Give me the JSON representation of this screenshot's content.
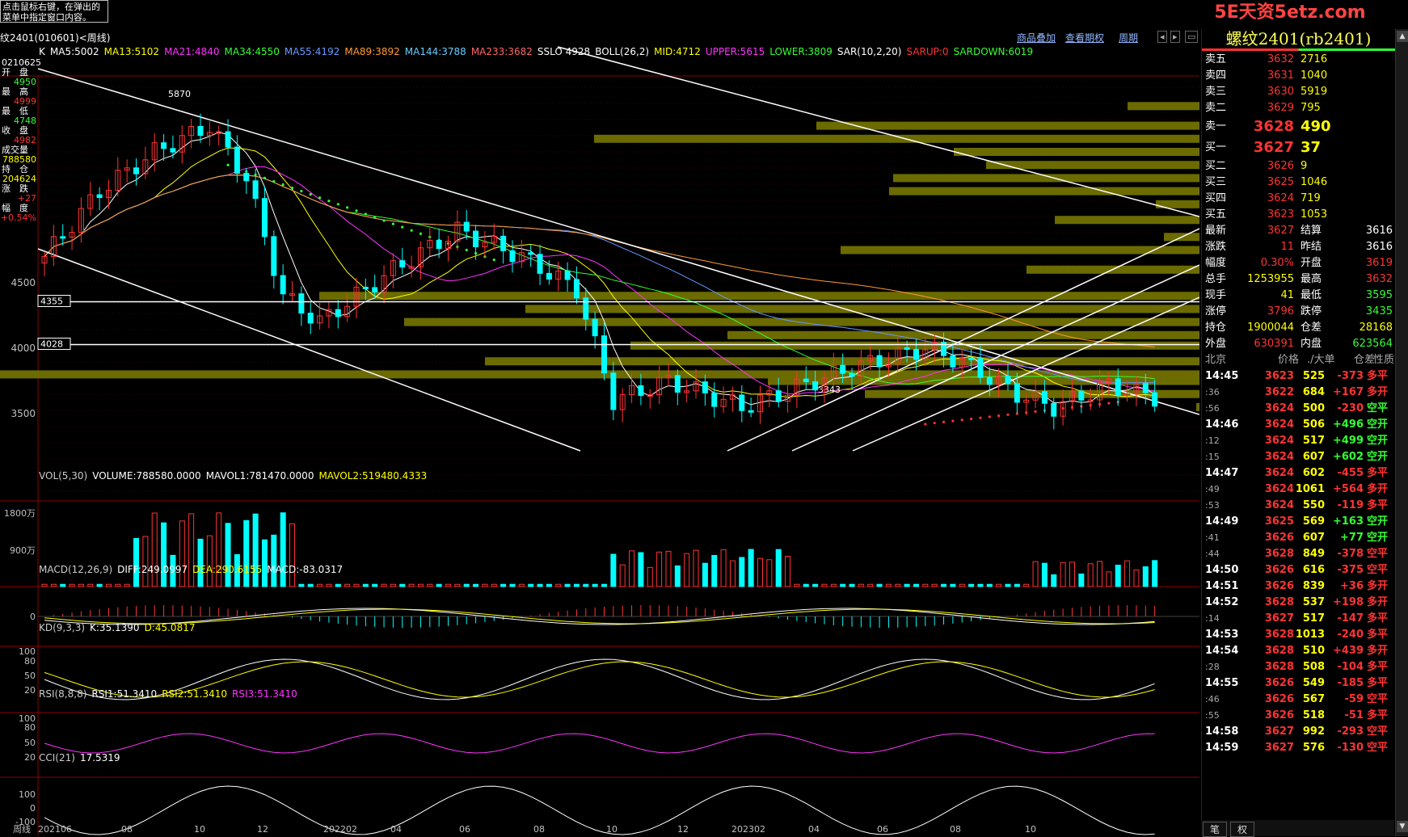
{
  "tooltip": {
    "lines": [
      "点击鼠标右键，在弹出的",
      "菜单中指定窗口内容。"
    ]
  },
  "brand": "5E天资5etz.com",
  "topbar": {
    "instrument": "纹2401(010601)<周线)",
    "links": [
      "商品叠加",
      "查看期权",
      "周期"
    ]
  },
  "legend_main": [
    {
      "text": "K",
      "color": "#ffffff"
    },
    {
      "text": "MA5:5002",
      "color": "#ffffff"
    },
    {
      "text": "MA13:5102",
      "color": "#ffff00"
    },
    {
      "text": "MA21:4840",
      "color": "#ff33ff"
    },
    {
      "text": "MA34:4550",
      "color": "#33ff33"
    },
    {
      "text": "MA55:4192",
      "color": "#6699ff"
    },
    {
      "text": "MA89:3892",
      "color": "#ff9933"
    },
    {
      "text": "MA144:3788",
      "color": "#66ccff"
    },
    {
      "text": "MA233:3682",
      "color": "#ff6666"
    },
    {
      "text": "SSLO 4928",
      "color": "#ffffff"
    },
    {
      "text": "BOLL(26,2)",
      "color": "#ffffff"
    },
    {
      "text": "MID:4712",
      "color": "#ffff00"
    },
    {
      "text": "UPPER:5615",
      "color": "#ff33ff"
    },
    {
      "text": "LOWER:3809",
      "color": "#33ff33"
    },
    {
      "text": "SAR(10,2,20)",
      "color": "#ffffff"
    },
    {
      "text": "SARUP:0",
      "color": "#ff3333"
    },
    {
      "text": "SARDOWN:6019",
      "color": "#33ff33"
    }
  ],
  "left_info": [
    {
      "label": "0210625",
      "value": ""
    },
    {
      "label": "开　盘",
      "value": "4950",
      "color": "#33ff33"
    },
    {
      "label": "最　高",
      "value": "4999",
      "color": "#ff3333"
    },
    {
      "label": "最　低",
      "value": "4748",
      "color": "#33ff33"
    },
    {
      "label": "收　盘",
      "value": "4982",
      "color": "#ff3333"
    },
    {
      "label": "成交量",
      "value": "788580",
      "color": "#ffff00"
    },
    {
      "label": "持　仓",
      "value": "204624",
      "color": "#ffff00"
    },
    {
      "label": "涨　跌",
      "value": "+27",
      "color": "#ff3333"
    },
    {
      "label": "幅　度",
      "value": "+0.54%",
      "color": "#ff3333"
    }
  ],
  "price_axis": {
    "labels": [
      "4500",
      "4000",
      "3500"
    ],
    "values": [
      4500,
      4000,
      3500
    ],
    "marks": [
      "4355",
      "4028"
    ]
  },
  "annotations": {
    "high": "5870",
    "low": "3343"
  },
  "vol": {
    "legend": [
      {
        "text": "VOL(5,30)",
        "color": "#cccccc"
      },
      {
        "text": "VOLUME:788580.0000",
        "color": "#ffffff"
      },
      {
        "text": "MAVOL1:781470.0000",
        "color": "#ffffff"
      },
      {
        "text": "MAVOL2:519480.4333",
        "color": "#ffff00"
      }
    ],
    "axis": [
      "1800万",
      "900万"
    ]
  },
  "macd": {
    "legend": [
      {
        "text": "MACD(12,26,9)",
        "color": "#cccccc"
      },
      {
        "text": "DIFF:249.0997",
        "color": "#ffffff"
      },
      {
        "text": "DEA:290.6155",
        "color": "#ffff00"
      },
      {
        "text": "MACD:-83.0317",
        "color": "#ffffff"
      }
    ],
    "axis": [
      "0"
    ]
  },
  "kd": {
    "legend": [
      {
        "text": "KD(9,3,3)",
        "color": "#cccccc"
      },
      {
        "text": "K:35.1390",
        "color": "#ffffff"
      },
      {
        "text": "D:45.0817",
        "color": "#ffff00"
      }
    ],
    "axis": [
      "100",
      "80",
      "50",
      "20"
    ]
  },
  "rsi": {
    "legend": [
      {
        "text": "RSI(8,8,8)",
        "color": "#cccccc"
      },
      {
        "text": "RSI1:51.3410",
        "color": "#ffffff"
      },
      {
        "text": "RSI2:51.3410",
        "color": "#ffff00"
      },
      {
        "text": "RSI3:51.3410",
        "color": "#ff33ff"
      }
    ],
    "axis": [
      "100",
      "80",
      "50",
      "20"
    ]
  },
  "cci": {
    "legend": [
      {
        "text": "CCI(21)",
        "color": "#cccccc"
      },
      {
        "text": "17.5319",
        "color": "#ffffff"
      }
    ],
    "axis": [
      "100",
      "0",
      "-100"
    ]
  },
  "time_axis": {
    "period_label": "周线",
    "labels": [
      "202106",
      "08",
      "10",
      "12",
      "202202",
      "04",
      "06",
      "08",
      "10",
      "12",
      "202302",
      "04",
      "06",
      "08",
      "10"
    ]
  },
  "quote": {
    "title": "螺纹2401(rb2401)",
    "asks": [
      {
        "label": "卖五",
        "price": "3632",
        "vol": "2716"
      },
      {
        "label": "卖四",
        "price": "3631",
        "vol": "1040"
      },
      {
        "label": "卖三",
        "price": "3630",
        "vol": "5919"
      },
      {
        "label": "卖二",
        "price": "3629",
        "vol": "795"
      },
      {
        "label": "卖一",
        "price": "3628",
        "vol": "490"
      }
    ],
    "bids": [
      {
        "label": "买一",
        "price": "3627",
        "vol": "37"
      },
      {
        "label": "买二",
        "price": "3626",
        "vol": "9"
      },
      {
        "label": "买三",
        "price": "3625",
        "vol": "1046"
      },
      {
        "label": "买四",
        "price": "3624",
        "vol": "719"
      },
      {
        "label": "买五",
        "price": "3623",
        "vol": "1053"
      }
    ],
    "stats": [
      {
        "l1": "最新",
        "v1": "3627",
        "c1": "#ff3333",
        "l2": "结算",
        "v2": "3616",
        "c2": "#ffffff"
      },
      {
        "l1": "涨跌",
        "v1": "11",
        "c1": "#ff3333",
        "l2": "昨结",
        "v2": "3616",
        "c2": "#ffffff"
      },
      {
        "l1": "幅度",
        "v1": "0.30%",
        "c1": "#ff3333",
        "l2": "开盘",
        "v2": "3619",
        "c2": "#ff3333"
      },
      {
        "l1": "总手",
        "v1": "1253955",
        "c1": "#ffff00",
        "l2": "最高",
        "v2": "3632",
        "c2": "#ff3333"
      },
      {
        "l1": "现手",
        "v1": "41",
        "c1": "#ffff00",
        "l2": "最低",
        "v2": "3595",
        "c2": "#33ff33"
      },
      {
        "l1": "涨停",
        "v1": "3796",
        "c1": "#ff3333",
        "l2": "跌停",
        "v2": "3435",
        "c2": "#33ff33"
      },
      {
        "l1": "持仓",
        "v1": "1900044",
        "c1": "#ffff00",
        "l2": "仓差",
        "v2": "28168",
        "c2": "#ffff00"
      },
      {
        "l1": "外盘",
        "v1": "630391",
        "c1": "#ff3333",
        "l2": "内盘",
        "v2": "623564",
        "c2": "#33ff33"
      }
    ],
    "ticks_header": [
      "北京",
      "价格",
      "./大单",
      "仓差",
      "性质"
    ],
    "ticks": [
      {
        "time": "14:45",
        "price": "3623",
        "pc": "#ff3333",
        "vol": "525",
        "diff": "-373",
        "dc": "#ff3333",
        "nature": "多平",
        "nc": "#ff3333",
        "major": true
      },
      {
        "time": ":36",
        "price": "3622",
        "pc": "#ff3333",
        "vol": "684",
        "diff": "+167",
        "dc": "#ff3333",
        "nature": "多开",
        "nc": "#ff3333",
        "major": false
      },
      {
        "time": ":56",
        "price": "3624",
        "pc": "#ff3333",
        "vol": "500",
        "diff": "-230",
        "dc": "#ff3333",
        "nature": "空平",
        "nc": "#33ff33",
        "major": false
      },
      {
        "time": "14:46",
        "price": "3624",
        "pc": "#ff3333",
        "vol": "506",
        "diff": "+496",
        "dc": "#33ff33",
        "nature": "空开",
        "nc": "#33ff33",
        "major": true
      },
      {
        "time": ":12",
        "price": "3624",
        "pc": "#ff3333",
        "vol": "517",
        "diff": "+499",
        "dc": "#33ff33",
        "nature": "空开",
        "nc": "#33ff33",
        "major": false
      },
      {
        "time": ":15",
        "price": "3624",
        "pc": "#ff3333",
        "vol": "607",
        "diff": "+602",
        "dc": "#33ff33",
        "nature": "空开",
        "nc": "#33ff33",
        "major": false
      },
      {
        "time": "14:47",
        "price": "3624",
        "pc": "#ff3333",
        "vol": "602",
        "diff": "-455",
        "dc": "#ff3333",
        "nature": "多平",
        "nc": "#ff3333",
        "major": true
      },
      {
        "time": ":49",
        "price": "3624",
        "pc": "#ff3333",
        "vol": "1061",
        "diff": "+564",
        "dc": "#ff3333",
        "nature": "多开",
        "nc": "#ff3333",
        "major": false
      },
      {
        "time": ":53",
        "price": "3624",
        "pc": "#ff3333",
        "vol": "550",
        "diff": "-119",
        "dc": "#ff3333",
        "nature": "多平",
        "nc": "#ff3333",
        "major": false
      },
      {
        "time": "14:49",
        "price": "3625",
        "pc": "#ff3333",
        "vol": "569",
        "diff": "+163",
        "dc": "#33ff33",
        "nature": "空开",
        "nc": "#33ff33",
        "major": true
      },
      {
        "time": ":41",
        "price": "3626",
        "pc": "#ff3333",
        "vol": "607",
        "diff": "+77",
        "dc": "#33ff33",
        "nature": "空开",
        "nc": "#33ff33",
        "major": false
      },
      {
        "time": ":44",
        "price": "3628",
        "pc": "#ff3333",
        "vol": "849",
        "diff": "-378",
        "dc": "#ff3333",
        "nature": "空平",
        "nc": "#ff3333",
        "major": false
      },
      {
        "time": "14:50",
        "price": "3626",
        "pc": "#ff3333",
        "vol": "616",
        "diff": "-375",
        "dc": "#ff3333",
        "nature": "空平",
        "nc": "#ff3333",
        "major": true
      },
      {
        "time": "14:51",
        "price": "3626",
        "pc": "#ff3333",
        "vol": "839",
        "diff": "+36",
        "dc": "#ff3333",
        "nature": "多开",
        "nc": "#ff3333",
        "major": true
      },
      {
        "time": "14:52",
        "price": "3628",
        "pc": "#ff3333",
        "vol": "537",
        "diff": "+198",
        "dc": "#ff3333",
        "nature": "多开",
        "nc": "#ff3333",
        "major": true
      },
      {
        "time": ":14",
        "price": "3627",
        "pc": "#ff3333",
        "vol": "517",
        "diff": "-147",
        "dc": "#ff3333",
        "nature": "多平",
        "nc": "#ff3333",
        "major": false
      },
      {
        "time": "14:53",
        "price": "3628",
        "pc": "#ff3333",
        "vol": "1013",
        "diff": "-240",
        "dc": "#ff3333",
        "nature": "多平",
        "nc": "#ff3333",
        "major": true
      },
      {
        "time": "14:54",
        "price": "3628",
        "pc": "#ff3333",
        "vol": "510",
        "diff": "+439",
        "dc": "#ff3333",
        "nature": "多开",
        "nc": "#ff3333",
        "major": true
      },
      {
        "time": ":28",
        "price": "3628",
        "pc": "#ff3333",
        "vol": "508",
        "diff": "-104",
        "dc": "#ff3333",
        "nature": "多平",
        "nc": "#ff3333",
        "major": false
      },
      {
        "time": "14:55",
        "price": "3626",
        "pc": "#ff3333",
        "vol": "549",
        "diff": "-185",
        "dc": "#ff3333",
        "nature": "多平",
        "nc": "#ff3333",
        "major": true
      },
      {
        "time": ":46",
        "price": "3626",
        "pc": "#ff3333",
        "vol": "567",
        "diff": "-59",
        "dc": "#ff3333",
        "nature": "空平",
        "nc": "#ff3333",
        "major": false
      },
      {
        "time": ":55",
        "price": "3626",
        "pc": "#ff3333",
        "vol": "518",
        "diff": "-51",
        "dc": "#ff3333",
        "nature": "多平",
        "nc": "#ff3333",
        "major": false
      },
      {
        "time": "14:58",
        "price": "3627",
        "pc": "#ff3333",
        "vol": "992",
        "diff": "-293",
        "dc": "#ff3333",
        "nature": "空平",
        "nc": "#ff3333",
        "major": true
      },
      {
        "time": "14:59",
        "price": "3627",
        "pc": "#ff3333",
        "vol": "576",
        "diff": "-130",
        "dc": "#ff3333",
        "nature": "空平",
        "nc": "#ff3333",
        "major": true
      }
    ],
    "bottom_tabs": [
      "笔",
      "权"
    ]
  },
  "colors": {
    "up": "#ff3333",
    "down": "#00ffff",
    "grid": "#8b0000",
    "profile": "#6b6b00"
  }
}
